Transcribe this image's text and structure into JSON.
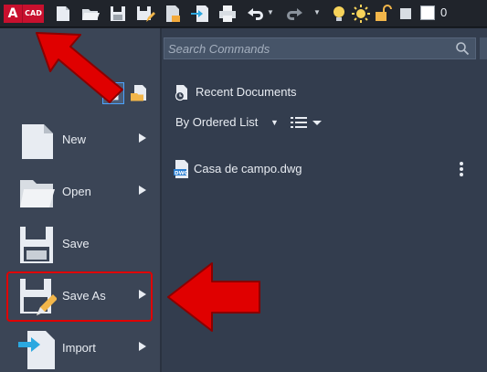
{
  "toolbar": {
    "app_letter": "A",
    "app_badge": "CAD",
    "icons": [
      "new-icon",
      "open-icon",
      "save-icon",
      "save-as-icon",
      "export-icon",
      "import-icon",
      "print-icon",
      "undo-icon",
      "redo-icon",
      "bulb-icon",
      "sun-icon",
      "lock-icon"
    ],
    "layer_value": "0"
  },
  "search": {
    "placeholder": "Search Commands"
  },
  "recent": {
    "title": "Recent Documents",
    "order_by": "By Ordered List",
    "files": [
      {
        "name": "Casa de campo.dwg",
        "badge": "DWG"
      }
    ]
  },
  "menu": {
    "items": [
      {
        "label": "New",
        "icon": "new-file-icon"
      },
      {
        "label": "Open",
        "icon": "open-folder-icon"
      },
      {
        "label": "Save",
        "icon": "floppy-disk-icon"
      },
      {
        "label": "Save As",
        "icon": "save-as-icon"
      },
      {
        "label": "Import",
        "icon": "import-icon"
      }
    ]
  },
  "colors": {
    "annotation": "#e00000",
    "menu_bg": "#3b4556",
    "app_red": "#c8102e"
  }
}
